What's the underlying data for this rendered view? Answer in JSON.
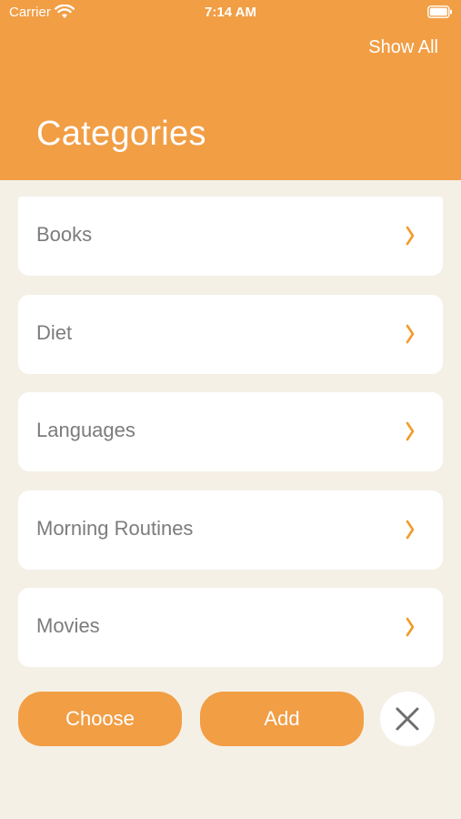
{
  "status_bar": {
    "carrier": "Carrier",
    "time": "7:14 AM"
  },
  "header": {
    "show_all_label": "Show All",
    "title": "Categories"
  },
  "categories": [
    {
      "label": "Books"
    },
    {
      "label": "Diet"
    },
    {
      "label": "Languages"
    },
    {
      "label": "Morning Routines"
    },
    {
      "label": "Movies"
    }
  ],
  "actions": {
    "choose_label": "Choose",
    "add_label": "Add"
  },
  "icons": {
    "row_chevron": "chevron-right-icon",
    "close": "close-icon"
  },
  "colors": {
    "accent": "#F19E45",
    "background": "#F5F0E6",
    "row_text": "#7C7C7C",
    "chevron": "#F39A2B"
  }
}
